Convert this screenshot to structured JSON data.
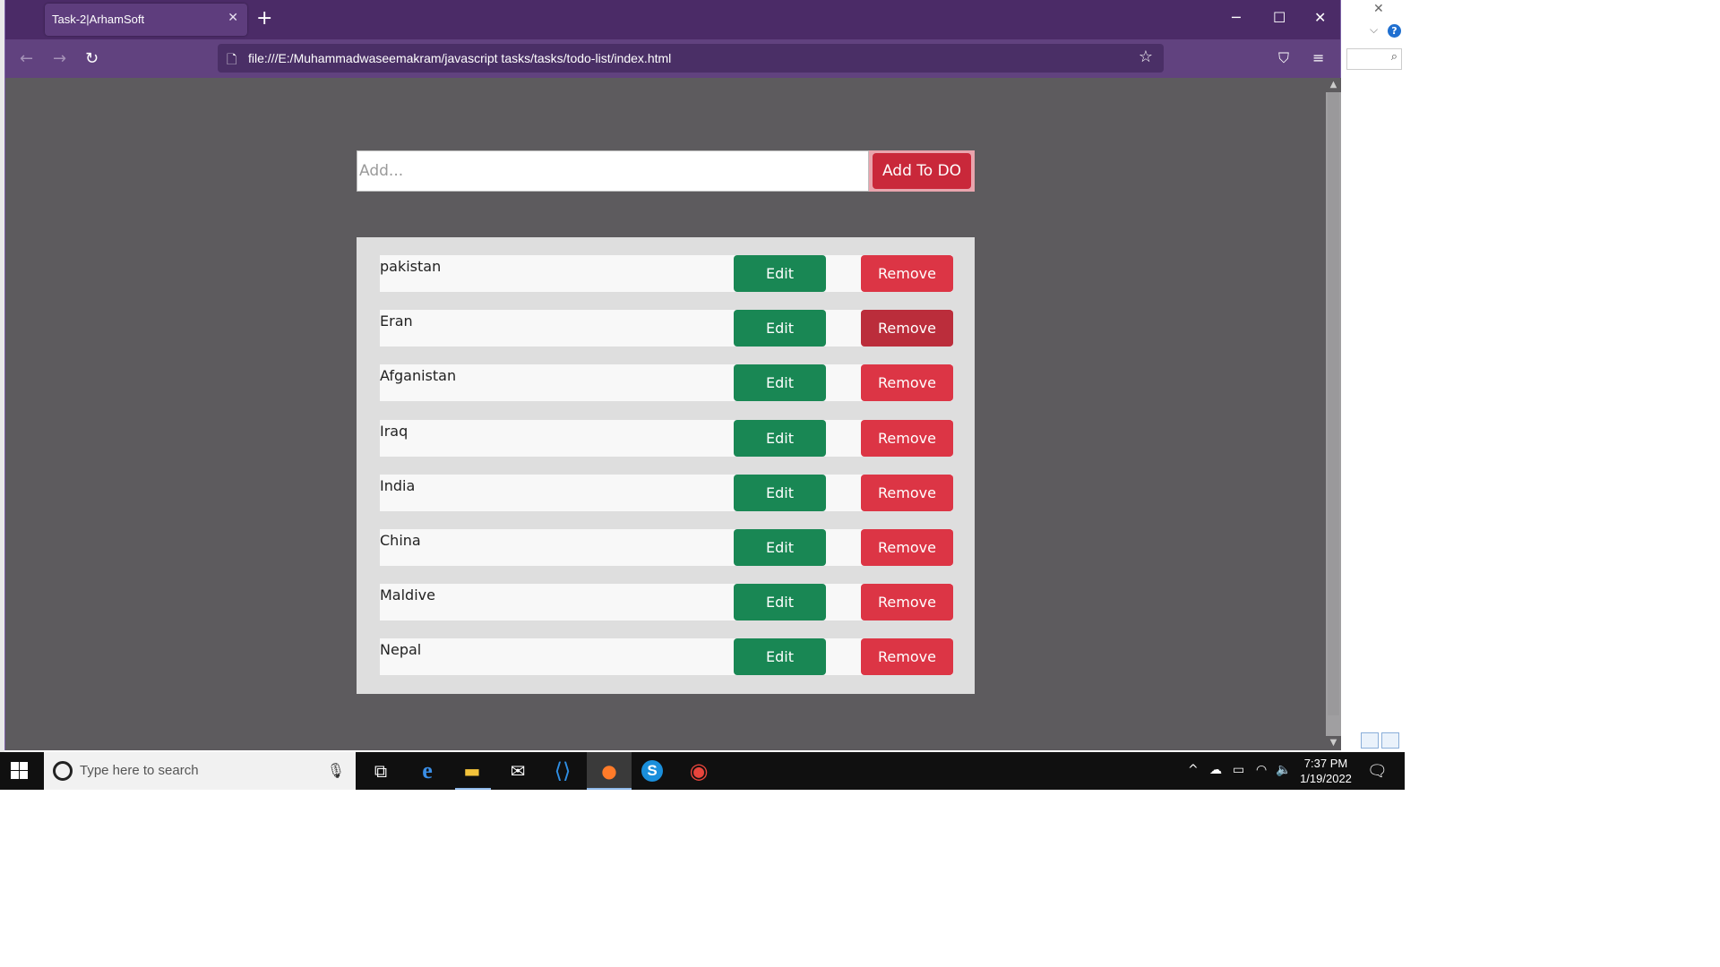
{
  "browser": {
    "tab_title": "Task-2|ArhamSoft",
    "tab_close": "✕",
    "new_tab": "+",
    "url": "file:///E:/Muhammadwaseemakram/javascript tasks/tasks/todo-list/index.html",
    "accent_color": "#4b2b67"
  },
  "todo": {
    "input_placeholder": "Add...",
    "input_value": "",
    "add_button_label": "Add To DO",
    "edit_label": "Edit",
    "remove_label": "Remove",
    "items": [
      {
        "text": "pakistan"
      },
      {
        "text": "Eran"
      },
      {
        "text": "Afganistan"
      },
      {
        "text": "Iraq"
      },
      {
        "text": "India"
      },
      {
        "text": "China"
      },
      {
        "text": "Maldive"
      },
      {
        "text": "Nepal"
      }
    ],
    "colors": {
      "edit": "#198754",
      "remove": "#dc3545",
      "add": "#c9283a"
    }
  },
  "taskbar": {
    "search_placeholder": "Type here to search",
    "time": "7:37 PM",
    "date": "1/19/2022",
    "apps": [
      "task-view-icon",
      "edge-icon",
      "file-explorer-icon",
      "mail-icon",
      "vscode-icon",
      "firefox-icon",
      "skype-icon",
      "chrome-icon"
    ]
  }
}
